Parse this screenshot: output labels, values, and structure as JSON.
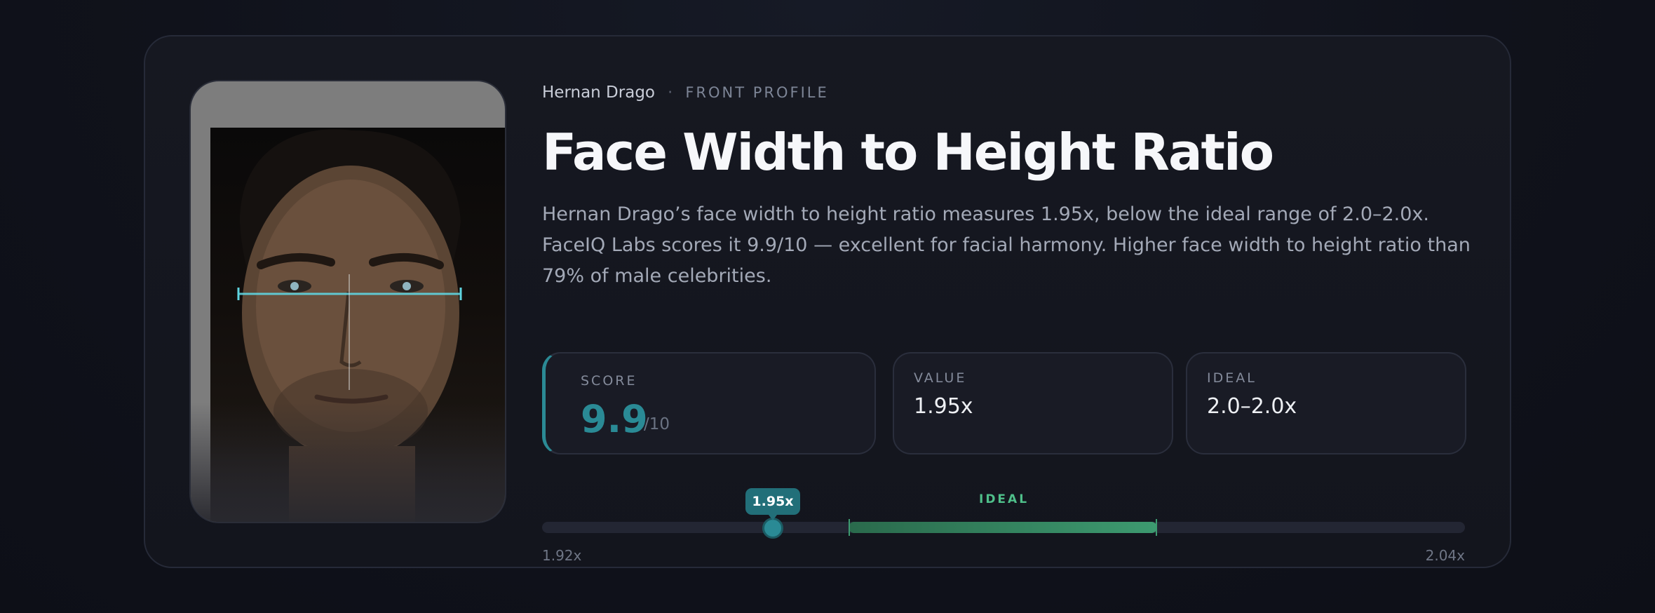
{
  "subject": {
    "name": "Hernan Drago",
    "separator": "·",
    "profile": "FRONT PROFILE"
  },
  "title": "Face Width to Height Ratio",
  "description": "Hernan Drago’s face width to height ratio measures 1.95x, below the ideal range of 2.0–2.0x. FaceIQ Labs scores it 9.9/10 — excellent for facial harmony. Higher face width to height ratio than 79% of male celebrities.",
  "stats": {
    "score": {
      "label": "SCORE",
      "value": "9.9",
      "denominator": "/10"
    },
    "value": {
      "label": "VALUE",
      "value": "1.95x"
    },
    "ideal": {
      "label": "IDEAL",
      "value": "2.0–2.0x"
    }
  },
  "range": {
    "ideal_label": "IDEAL",
    "marker_label": "1.95x",
    "min_label": "1.92x",
    "max_label": "2.04x",
    "min": 1.92,
    "max": 2.04,
    "marker_value": 1.95
  },
  "colors": {
    "accent": "#2a8a95",
    "ideal": "#3d9a70",
    "overlay": "#5fd4e0"
  }
}
